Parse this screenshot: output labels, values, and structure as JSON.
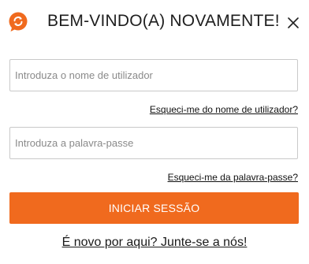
{
  "header": {
    "title": "BEM-VINDO(A) NOVAMENTE!",
    "logo_icon": "chat-bubble-logo-icon",
    "close_icon": "close-icon"
  },
  "form": {
    "username_placeholder": "Introduza o nome de utilizador",
    "username_value": "",
    "forgot_username_link": "Esqueci-me do nome de utilizador?",
    "password_placeholder": "Introduza a palavra-passe",
    "password_value": "",
    "forgot_password_link": "Esqueci-me da palavra-passe?",
    "submit_label": "INICIAR SESSÃO"
  },
  "footer": {
    "signup_link": "É novo por aqui? Junte-se a nós!"
  },
  "colors": {
    "accent": "#f06a1e",
    "text": "#1e1e1e",
    "border": "#c9c9c9"
  }
}
